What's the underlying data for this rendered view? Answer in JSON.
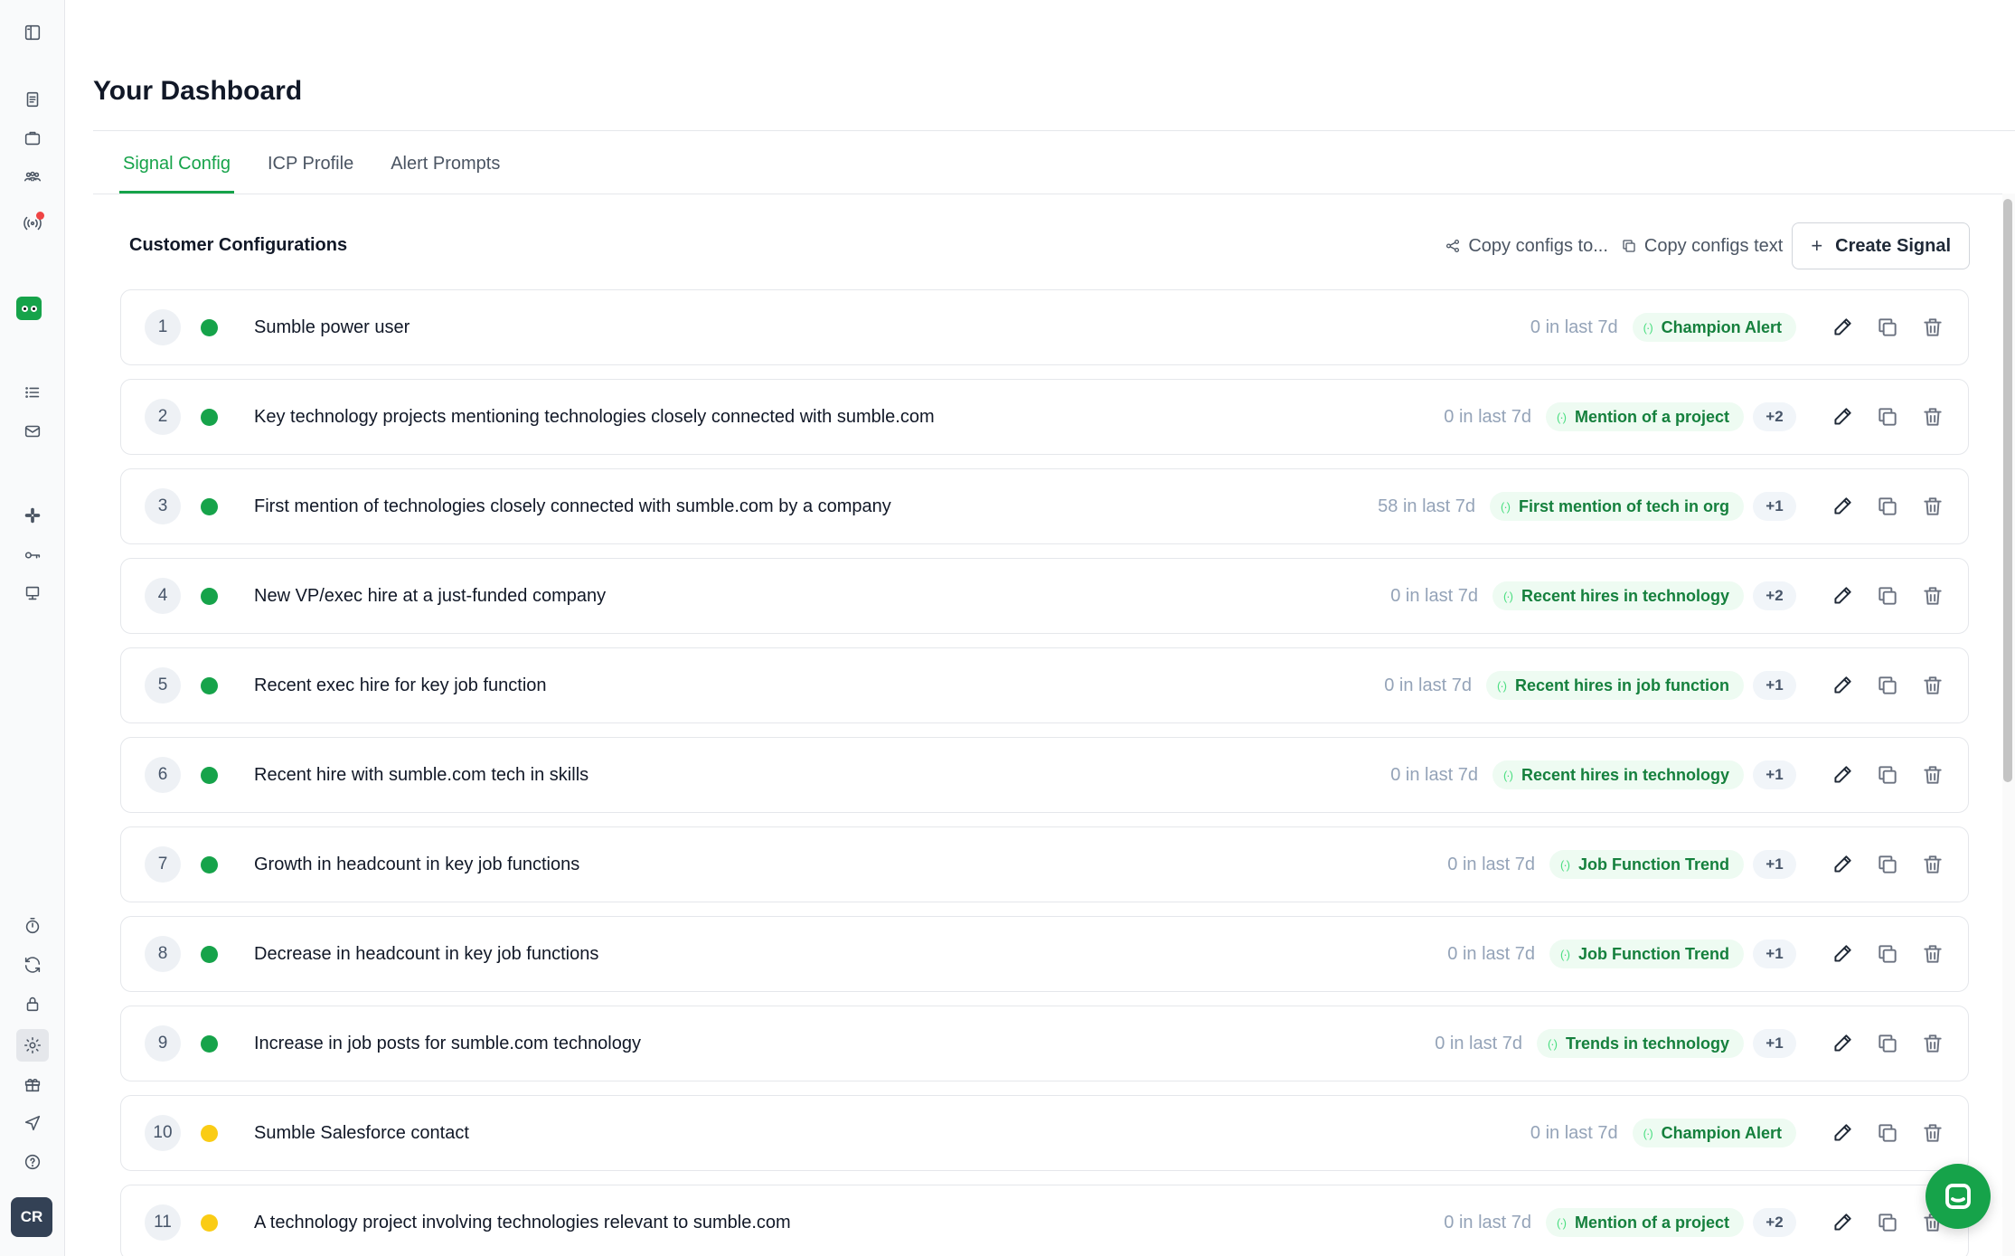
{
  "sidebar": {
    "icons": [
      "panel-toggle-icon",
      "document-icon",
      "briefcase-icon",
      "people-icon",
      "signal-icon",
      "brand-logo",
      "list-icon",
      "mail-icon",
      "slack-icon",
      "key-icon",
      "monitor-icon",
      "timer-icon",
      "refresh-icon",
      "lock-icon",
      "gear-icon",
      "gift-icon",
      "send-icon",
      "help-icon"
    ],
    "avatar_initials": "CR"
  },
  "page": {
    "title": "Your Dashboard"
  },
  "tabs": [
    {
      "label": "Signal Config",
      "active": true
    },
    {
      "label": "ICP Profile",
      "active": false
    },
    {
      "label": "Alert Prompts",
      "active": false
    }
  ],
  "section": {
    "title": "Customer Configurations",
    "copy_configs_to": "Copy configs to...",
    "copy_configs_text": "Copy configs text",
    "create_signal": "Create Signal"
  },
  "rows": [
    {
      "num": "1",
      "status": "green",
      "title": "Sumble power user",
      "count": "0 in last 7d",
      "badge": "Champion Alert",
      "extra": ""
    },
    {
      "num": "2",
      "status": "green",
      "title": "Key technology projects mentioning technologies closely connected with sumble.com",
      "count": "0 in last 7d",
      "badge": "Mention of a project",
      "extra": "+2"
    },
    {
      "num": "3",
      "status": "green",
      "title": "First mention of technologies closely connected with sumble.com by a company",
      "count": "58 in last 7d",
      "badge": "First mention of tech in org",
      "extra": "+1"
    },
    {
      "num": "4",
      "status": "green",
      "title": "New VP/exec hire at a just-funded company",
      "count": "0 in last 7d",
      "badge": "Recent hires in technology",
      "extra": "+2"
    },
    {
      "num": "5",
      "status": "green",
      "title": "Recent exec hire for key job function",
      "count": "0 in last 7d",
      "badge": "Recent hires in job function",
      "extra": "+1"
    },
    {
      "num": "6",
      "status": "green",
      "title": "Recent hire with sumble.com tech in skills",
      "count": "0 in last 7d",
      "badge": "Recent hires in technology",
      "extra": "+1"
    },
    {
      "num": "7",
      "status": "green",
      "title": "Growth in headcount in key job functions",
      "count": "0 in last 7d",
      "badge": "Job Function Trend",
      "extra": "+1"
    },
    {
      "num": "8",
      "status": "green",
      "title": "Decrease in headcount in key job functions",
      "count": "0 in last 7d",
      "badge": "Job Function Trend",
      "extra": "+1"
    },
    {
      "num": "9",
      "status": "green",
      "title": "Increase in job posts for sumble.com technology",
      "count": "0 in last 7d",
      "badge": "Trends in technology",
      "extra": "+1"
    },
    {
      "num": "10",
      "status": "yellow",
      "title": "Sumble Salesforce contact",
      "count": "0 in last 7d",
      "badge": "Champion Alert",
      "extra": ""
    },
    {
      "num": "11",
      "status": "yellow",
      "title": "A technology project involving technologies relevant to sumble.com",
      "count": "0 in last 7d",
      "badge": "Mention of a project",
      "extra": "+2"
    }
  ],
  "colors": {
    "accent": "#16a34a",
    "status_green": "#16a34a",
    "status_yellow": "#facc15",
    "badge_bg": "#eefbf2",
    "notification": "#ef4444"
  }
}
